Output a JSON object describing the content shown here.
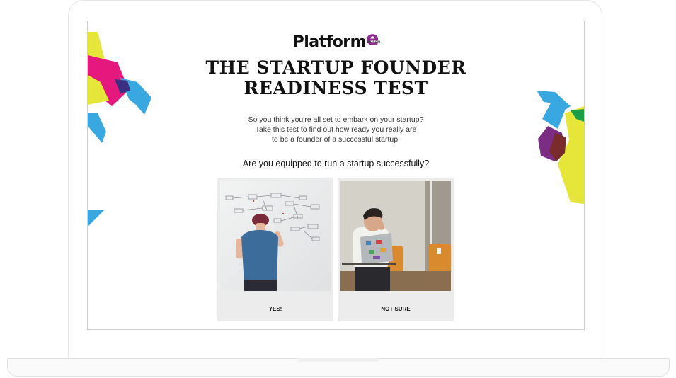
{
  "page": {
    "logo": {
      "word": "Platform",
      "e": "e",
      "sub": "BY SGM"
    },
    "title_line1": "THE STARTUP FOUNDER",
    "title_line2": "READINESS TEST",
    "intro_lines": [
      "So you think you're all set to embark on your startup?",
      "Take this test to find out how ready you really are",
      "to be a founder of a successful startup."
    ],
    "question": "Are you equipped to run a startup successfully?",
    "answers": [
      {
        "label": "YES!"
      },
      {
        "label": "NOT SURE"
      }
    ]
  },
  "colors": {
    "brand_purple": "#8f2c8f",
    "deco_yellow": "#e5e53a",
    "deco_pink": "#e5197d",
    "deco_blue": "#3aa8e0",
    "deco_purple": "#7b2d84",
    "deco_green": "#1a9e48",
    "card_bg": "#ececec"
  }
}
